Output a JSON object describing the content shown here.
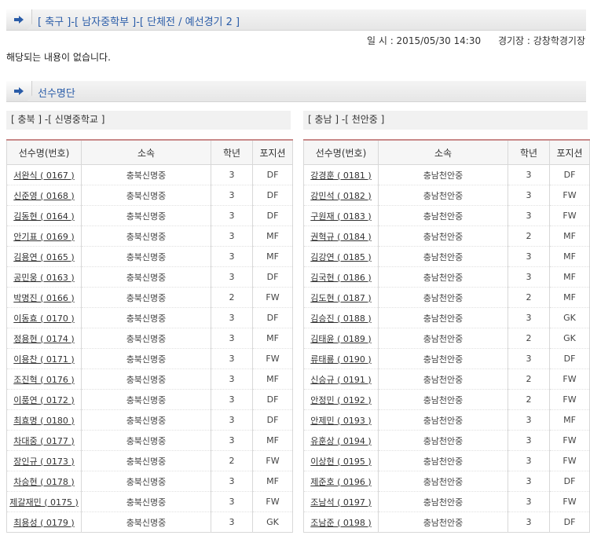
{
  "match_header": {
    "title": "[ 축구 ]-[ 남자중학부 ]-[ 단체전 / 예선경기 2 ]"
  },
  "match_info": {
    "datetime": "일 시 : 2015/05/30 14:30",
    "venue": "경기장 : 강창학경기장"
  },
  "no_content": "해당되는 내용이 없습니다.",
  "roster_header": {
    "title": "선수명단"
  },
  "columns": {
    "name": "선수명(번호)",
    "team": "소속",
    "grade": "학년",
    "position": "포지션"
  },
  "team_left": {
    "heading": "[ 충북 ] -[ 신명중학교 ]",
    "players": [
      {
        "name": "서완식 ( 0167 )",
        "team": "충북신명중",
        "grade": "3",
        "position": "DF"
      },
      {
        "name": "신준영 ( 0168 )",
        "team": "충북신명중",
        "grade": "3",
        "position": "DF"
      },
      {
        "name": "김동현 ( 0164 )",
        "team": "충북신명중",
        "grade": "3",
        "position": "DF"
      },
      {
        "name": "안기표 ( 0169 )",
        "team": "충북신명중",
        "grade": "3",
        "position": "MF"
      },
      {
        "name": "김용연 ( 0165 )",
        "team": "충북신명중",
        "grade": "3",
        "position": "MF"
      },
      {
        "name": "공민웅 ( 0163 )",
        "team": "충북신명중",
        "grade": "3",
        "position": "DF"
      },
      {
        "name": "박명진 ( 0166 )",
        "team": "충북신명중",
        "grade": "2",
        "position": "FW"
      },
      {
        "name": "이동효 ( 0170 )",
        "team": "충북신명중",
        "grade": "3",
        "position": "DF"
      },
      {
        "name": "정용현 ( 0174 )",
        "team": "충북신명중",
        "grade": "3",
        "position": "MF"
      },
      {
        "name": "이용찬 ( 0171 )",
        "team": "충북신명중",
        "grade": "3",
        "position": "FW"
      },
      {
        "name": "조진혁 ( 0176 )",
        "team": "충북신명중",
        "grade": "3",
        "position": "MF"
      },
      {
        "name": "이풍연 ( 0172 )",
        "team": "충북신명중",
        "grade": "3",
        "position": "DF"
      },
      {
        "name": "최효명 ( 0180 )",
        "team": "충북신명중",
        "grade": "3",
        "position": "DF"
      },
      {
        "name": "차대중 ( 0177 )",
        "team": "충북신명중",
        "grade": "3",
        "position": "MF"
      },
      {
        "name": "장인규 ( 0173 )",
        "team": "충북신명중",
        "grade": "2",
        "position": "FW"
      },
      {
        "name": "차승현 ( 0178 )",
        "team": "충북신명중",
        "grade": "3",
        "position": "MF"
      },
      {
        "name": "제갈재민 ( 0175 )",
        "team": "충북신명중",
        "grade": "3",
        "position": "FW"
      },
      {
        "name": "최용성 ( 0179 )",
        "team": "충북신명중",
        "grade": "3",
        "position": "GK"
      }
    ]
  },
  "team_right": {
    "heading": "[ 충남 ] -[ 천안중 ]",
    "players": [
      {
        "name": "강경훈 ( 0181 )",
        "team": "충남천안중",
        "grade": "3",
        "position": "DF"
      },
      {
        "name": "강민석 ( 0182 )",
        "team": "충남천안중",
        "grade": "3",
        "position": "FW"
      },
      {
        "name": "구원재 ( 0183 )",
        "team": "충남천안중",
        "grade": "3",
        "position": "FW"
      },
      {
        "name": "권혁규 ( 0184 )",
        "team": "충남천안중",
        "grade": "2",
        "position": "MF"
      },
      {
        "name": "김강연 ( 0185 )",
        "team": "충남천안중",
        "grade": "3",
        "position": "MF"
      },
      {
        "name": "김국현 ( 0186 )",
        "team": "충남천안중",
        "grade": "3",
        "position": "MF"
      },
      {
        "name": "김도현 ( 0187 )",
        "team": "충남천안중",
        "grade": "2",
        "position": "MF"
      },
      {
        "name": "김승진 ( 0188 )",
        "team": "충남천안중",
        "grade": "3",
        "position": "GK"
      },
      {
        "name": "김태윤 ( 0189 )",
        "team": "충남천안중",
        "grade": "2",
        "position": "GK"
      },
      {
        "name": "류태룡 ( 0190 )",
        "team": "충남천안중",
        "grade": "3",
        "position": "DF"
      },
      {
        "name": "신승규 ( 0191 )",
        "team": "충남천안중",
        "grade": "2",
        "position": "FW"
      },
      {
        "name": "안정민 ( 0192 )",
        "team": "충남천안중",
        "grade": "2",
        "position": "FW"
      },
      {
        "name": "안제민 ( 0193 )",
        "team": "충남천안중",
        "grade": "3",
        "position": "MF"
      },
      {
        "name": "유훈상 ( 0194 )",
        "team": "충남천안중",
        "grade": "3",
        "position": "FW"
      },
      {
        "name": "이상현 ( 0195 )",
        "team": "충남천안중",
        "grade": "3",
        "position": "FW"
      },
      {
        "name": "제준호 ( 0196 )",
        "team": "충남천안중",
        "grade": "3",
        "position": "DF"
      },
      {
        "name": "조남석 ( 0197 )",
        "team": "충남천안중",
        "grade": "3",
        "position": "FW"
      },
      {
        "name": "조남준 ( 0198 )",
        "team": "충남천안중",
        "grade": "3",
        "position": "DF"
      }
    ]
  },
  "colors": {
    "title_blue": "#2a5ca8",
    "table_top_border": "#c98a8a"
  },
  "icons": {
    "bar_tab": "arrow-right-icon"
  }
}
